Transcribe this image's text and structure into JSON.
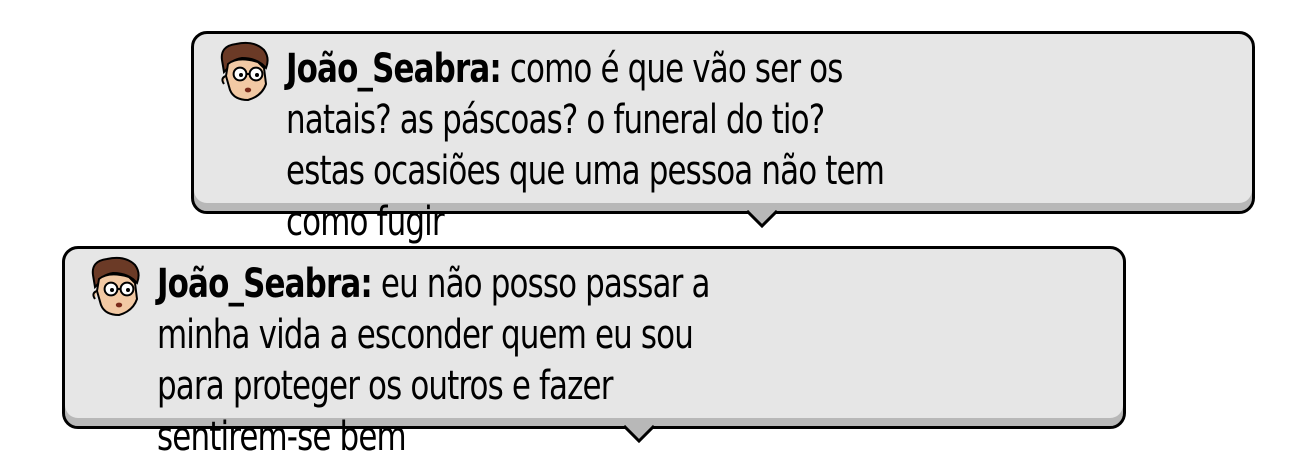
{
  "messages": [
    {
      "username": "João_Seabra:",
      "text": "como é que vão ser os natais? as páscoas? o funeral do tio? estas ocasiões que uma pessoa não tem como fugir",
      "avatar_icon": "habbo-avatar-icon"
    },
    {
      "username": "João_Seabra:",
      "text": "eu não posso passar a minha vida a esconder quem eu sou para proteger os outros e fazer sentirem-se bem",
      "avatar_icon": "habbo-avatar-icon"
    }
  ],
  "colors": {
    "bubble_fill": "#e6e6e6",
    "bubble_border": "#000000",
    "bubble_shadow": "#b8b8b8"
  }
}
